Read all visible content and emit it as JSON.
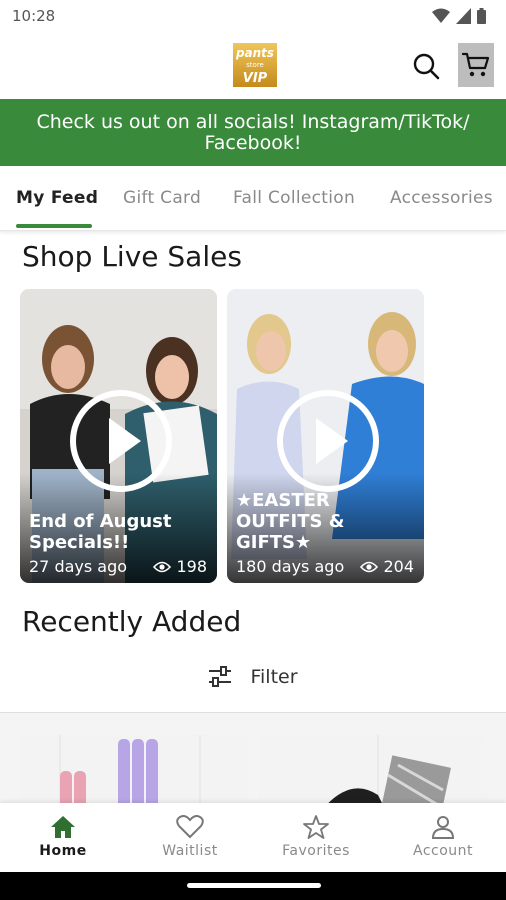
{
  "status_bar": {
    "time": "10:28",
    "icons": [
      "wifi-icon",
      "signal-icon",
      "battery-icon"
    ]
  },
  "header": {
    "logo_text": "pants store VIP",
    "search_icon": "search-icon",
    "cart_icon": "cart-icon"
  },
  "banner": {
    "text": "Check us out on all socials! Instagram/TikTok/ Facebook!",
    "color": "#3a8a3c"
  },
  "tabs": [
    {
      "label": "My Feed",
      "active": true
    },
    {
      "label": "Gift Card",
      "active": false
    },
    {
      "label": "Fall Collection",
      "active": false
    },
    {
      "label": "Accessories",
      "active": false
    }
  ],
  "live_sales": {
    "title": "Shop Live Sales",
    "cards": [
      {
        "title": "End of August Specials!!",
        "age": "27 days ago",
        "views": "198"
      },
      {
        "title": "★EASTER OUTFITS & GIFTS★",
        "age": "180 days ago",
        "views": "204"
      }
    ]
  },
  "recently_added": {
    "title": "Recently Added",
    "filter_label": "Filter"
  },
  "bottom_nav": [
    {
      "label": "Home",
      "icon": "home-icon",
      "active": true
    },
    {
      "label": "Waitlist",
      "icon": "heart-icon",
      "active": false
    },
    {
      "label": "Favorites",
      "icon": "star-icon",
      "active": false
    },
    {
      "label": "Account",
      "icon": "person-icon",
      "active": false
    }
  ],
  "colors": {
    "accent": "#3a8a3c",
    "logo_gold": "#d9a52a"
  }
}
